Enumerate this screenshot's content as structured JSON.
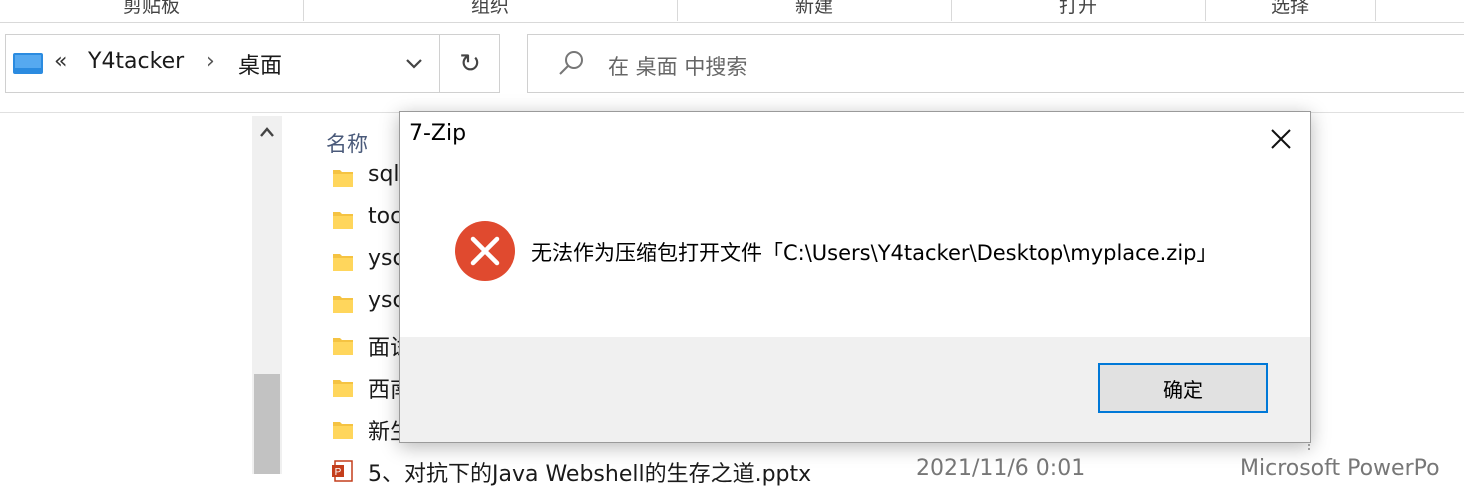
{
  "ribbon": {
    "groups": [
      "剪贴板",
      "组织",
      "新建",
      "打开",
      "选择"
    ]
  },
  "address": {
    "overflow": "«",
    "crumbs": [
      "Y4tacker",
      "桌面"
    ],
    "separator": "›"
  },
  "search": {
    "placeholder": "在 桌面 中搜索"
  },
  "files": {
    "column_name": "名称",
    "rows": [
      {
        "name": "sql",
        "icon": "folder-icon"
      },
      {
        "name": "toc",
        "icon": "folder-icon"
      },
      {
        "name": "ysc",
        "icon": "folder-icon"
      },
      {
        "name": "ysc",
        "icon": "folder-icon"
      },
      {
        "name": "面试",
        "icon": "folder-icon"
      },
      {
        "name": "西南",
        "icon": "folder-icon"
      },
      {
        "name": "新生",
        "icon": "folder-icon"
      },
      {
        "name": "5、对抗下的Java Webshell的生存之道.pptx",
        "icon": "powerpoint-icon",
        "date": "2021/11/6 0:01",
        "type": "Microsoft PowerPo"
      }
    ]
  },
  "dialog": {
    "title": "7-Zip",
    "message": "无法作为压缩包打开文件「C:\\Users\\Y4tacker\\Desktop\\myplace.zip」",
    "ok_label": "确定",
    "colors": {
      "error": "#e04a2f",
      "accent": "#0078d7"
    }
  }
}
